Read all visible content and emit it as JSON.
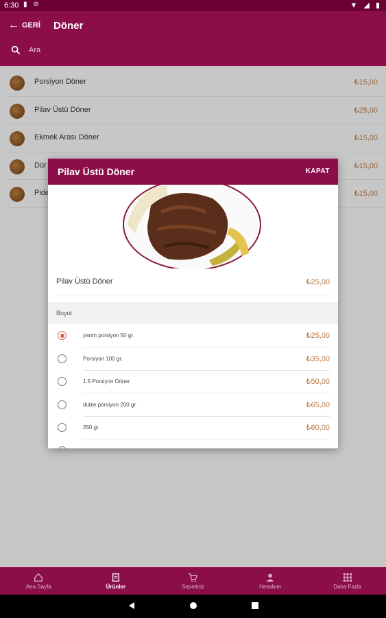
{
  "status": {
    "time": "6:30"
  },
  "header": {
    "back_label": "GERİ",
    "title": "Döner",
    "search_placeholder": "Ara"
  },
  "products": [
    {
      "name": "Porsiyon Döner",
      "price": "₺15,00"
    },
    {
      "name": "Pilav Üstü Döner",
      "price": "₺25,00"
    },
    {
      "name": "Ekmek Arası Döner",
      "price": "₺15,00"
    },
    {
      "name": "Dür",
      "price": "₺15,00"
    },
    {
      "name": "Pide",
      "price": "₺15,00"
    }
  ],
  "dialog": {
    "title": "Pilav Üstü Döner",
    "close_label": "KAPAT",
    "product_name": "Pilav Üstü Döner",
    "product_price": "₺25,00",
    "section_title": "Boyut",
    "options": [
      {
        "label": "yarım porsiyon 50 gr.",
        "price": "₺25,00",
        "selected": true
      },
      {
        "label": "Porsiyon 100 gr.",
        "price": "₺35,00",
        "selected": false
      },
      {
        "label": "1.5 Porsiyon Döner",
        "price": "₺50,00",
        "selected": false
      },
      {
        "label": "duble porsiyon 200 gr.",
        "price": "₺65,00",
        "selected": false
      },
      {
        "label": "250 gr.",
        "price": "₺80,00",
        "selected": false
      }
    ]
  },
  "bottom_nav": [
    {
      "label": "Ana Sayfa",
      "icon": "home-icon",
      "active": false
    },
    {
      "label": "Ürünler",
      "icon": "menu-book-icon",
      "active": true
    },
    {
      "label": "Sepetiniz",
      "icon": "cart-icon",
      "active": false
    },
    {
      "label": "Hesabım",
      "icon": "person-icon",
      "active": false
    },
    {
      "label": "Daha Fazla",
      "icon": "grid-icon",
      "active": false
    }
  ],
  "colors": {
    "brand": "#8b0d49",
    "price": "#b57a4a",
    "radio_selected": "#d06a4c"
  }
}
